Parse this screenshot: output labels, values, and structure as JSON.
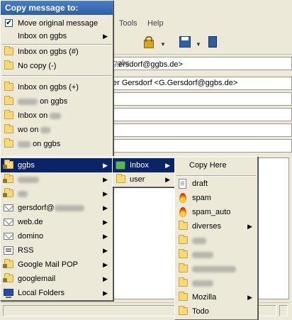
{
  "menubar": {
    "tools": "Tools",
    "help": "Help"
  },
  "headers": {
    "from": "ersdorf@ggbs.de>",
    "from_account": "ggbs",
    "to": "er Gersdorf <G.Gersdorf@ggbs.de>"
  },
  "copy_menu": {
    "title": "Copy message to:",
    "move_original": "Move original message",
    "move_checked": true,
    "account": "Inbox on ggbs",
    "recent": [
      {
        "label": "Inbox on ggbs (#)"
      },
      {
        "label": "No copy (-)"
      }
    ],
    "favorites": [
      {
        "label": "Inbox on ggbs (+)"
      },
      {
        "label_suffix": "on ggbs"
      },
      {
        "label": "Inbox on"
      },
      {
        "label": "wo on"
      },
      {
        "label_suffix": "on ggbs"
      }
    ]
  },
  "accounts_menu": {
    "items": [
      {
        "label": "ggbs",
        "icon": "folder-lock-icon",
        "highlighted": true
      },
      {
        "label": "",
        "icon": "folder-lock-icon"
      },
      {
        "label": "",
        "icon": "folder-lock-icon"
      },
      {
        "label": "gersdorf@",
        "icon": "envelope-icon"
      },
      {
        "label": "web.de",
        "icon": "envelope-icon"
      },
      {
        "label": "domino",
        "icon": "envelope-icon"
      },
      {
        "label": "RSS",
        "icon": "rss-icon"
      },
      {
        "label": "Google Mail POP",
        "icon": "folder-lock-icon"
      },
      {
        "label": "googlemail",
        "icon": "folder-lock-icon"
      },
      {
        "label": "Local Folders",
        "icon": "computer-icon"
      }
    ]
  },
  "ggbs_menu": {
    "items": [
      {
        "label": "Inbox",
        "icon": "inbox-icon",
        "highlighted": true
      },
      {
        "label": "user",
        "icon": "folder-icon"
      }
    ]
  },
  "inbox_menu": {
    "copy_here": "Copy Here",
    "items": [
      {
        "label": "draft",
        "icon": "document-icon",
        "submenu": false
      },
      {
        "label": "spam",
        "icon": "flame-icon",
        "submenu": false
      },
      {
        "label": "spam_auto",
        "icon": "flame-icon",
        "submenu": false
      },
      {
        "label": "diverses",
        "icon": "folder-icon",
        "submenu": true
      },
      {
        "label": "",
        "icon": "folder-icon",
        "submenu": false
      },
      {
        "label": "",
        "icon": "folder-icon",
        "submenu": false
      },
      {
        "label": "",
        "icon": "folder-icon",
        "submenu": false
      },
      {
        "label": "",
        "icon": "folder-icon",
        "submenu": false
      },
      {
        "label": "Mozilla",
        "icon": "folder-icon",
        "submenu": true
      },
      {
        "label": "Todo",
        "icon": "folder-icon",
        "submenu": false
      }
    ]
  },
  "colors": {
    "menu_bg": "#ece9d8",
    "highlight": "#0a246a",
    "title_bar": "#2c5fa8"
  }
}
